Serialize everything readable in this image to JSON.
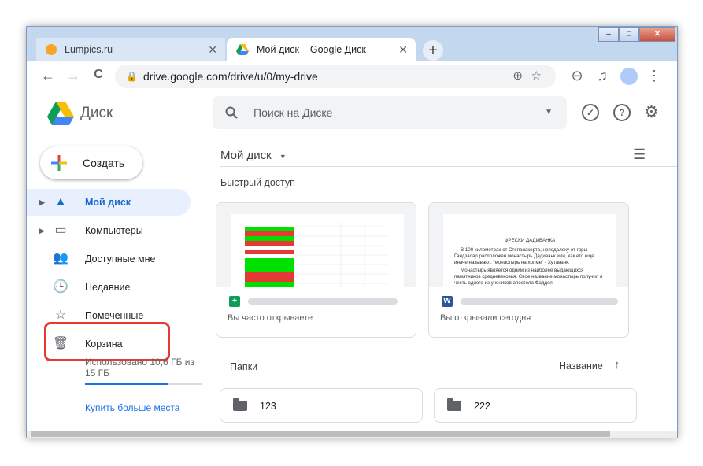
{
  "browser": {
    "tabs": [
      {
        "label": "Lumpics.ru",
        "close": "✕"
      },
      {
        "label": "Мой диск – Google Диск",
        "close": "✕"
      }
    ],
    "new_tab": "+",
    "window_buttons": {
      "minimize": "–",
      "maximize": "□",
      "close": "✕"
    },
    "url": "drive.google.com/drive/u/0/my-drive",
    "icons": {
      "back": "←",
      "forward": "→",
      "reload": "C",
      "lock": "🔒",
      "zoom_in": "⊕",
      "zoom_out": "⊖",
      "star": "☆",
      "media": "♫",
      "menu": "⋮"
    }
  },
  "drive": {
    "logo_text": "Диск",
    "search_placeholder": "Поиск на Диске",
    "search_icon": "🔍",
    "search_dropdown": "▼",
    "header_icons": {
      "status": "✓",
      "help": "?",
      "settings": "⚙"
    },
    "create_label": "Создать",
    "nav": [
      {
        "label": "Мой диск",
        "icon": "▲",
        "arrow": "▶"
      },
      {
        "label": "Компьютеры",
        "icon": "▭",
        "arrow": "▶"
      },
      {
        "label": "Доступные мне",
        "icon": "👥"
      },
      {
        "label": "Недавние",
        "icon": "🕒"
      },
      {
        "label": "Помеченные",
        "icon": "☆"
      },
      {
        "label": "Корзина",
        "icon": "🗑"
      }
    ],
    "storage_text": "Использовано 10,6 ГБ из 15 ГБ",
    "storage_fraction": 0.707,
    "buy_storage": "Купить больше места",
    "breadcrumb": "Мой диск",
    "breadcrumb_caret": "▼",
    "list_view_icon": "☰",
    "quick_access_title": "Быстрый доступ",
    "quick_access": [
      {
        "file_icon": "+",
        "subtitle": "Вы часто открываете",
        "color": "#0f9d58"
      },
      {
        "file_icon": "W",
        "subtitle": "Вы открывали сегодня",
        "color": "#2b579a"
      }
    ],
    "doc_preview": {
      "title": "ФРЕСКИ ДАДИВАНКА",
      "para1": "В 100 километрах от Степанакерта, неподалеку от горы Гандзасар расположен монастырь Дадиванк или, как его еще иначе называют, \"монастырь на холме\" - Хутаванк.",
      "para2": "Монастырь является одним из наиболее выдающихся памятников средневековья. Свое название монастырь получил в честь одного из учеников апостола Фаддея"
    },
    "folders_title": "Папки",
    "sort_label": "Название",
    "sort_arrow": "↑",
    "folders": [
      {
        "name": "123"
      },
      {
        "name": "222"
      }
    ]
  }
}
